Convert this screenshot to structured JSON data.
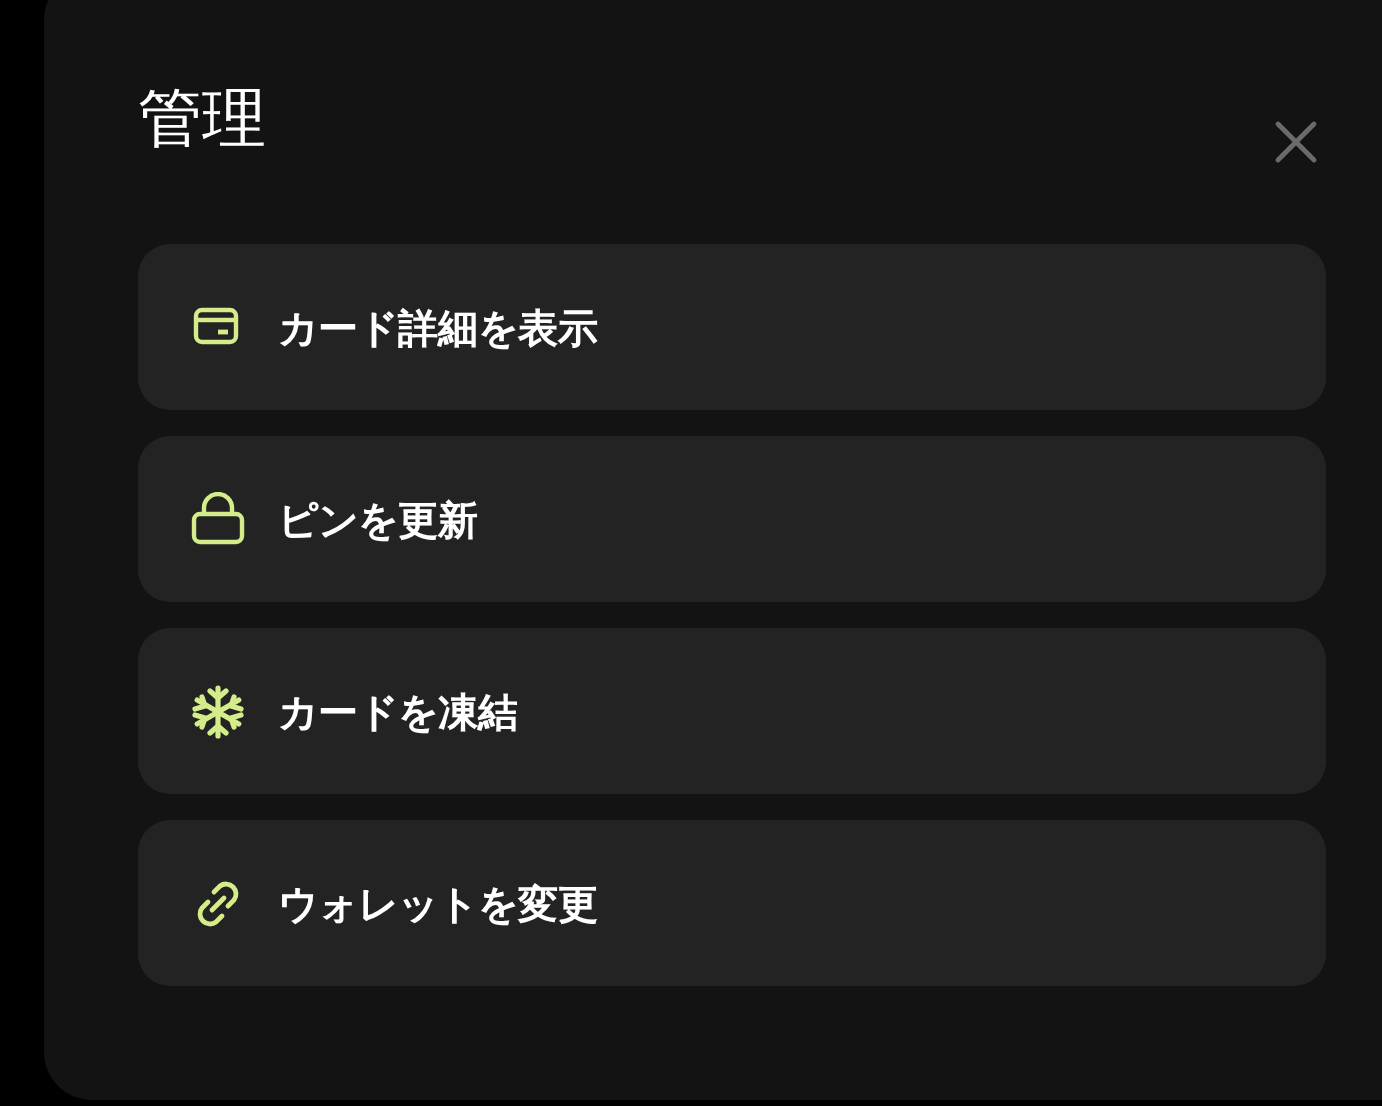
{
  "dialog": {
    "title": "管理",
    "items": [
      {
        "kind": "card",
        "label": "カード詳細を表示"
      },
      {
        "kind": "lock",
        "label": "ピンを更新"
      },
      {
        "kind": "snowflake",
        "label": "カードを凍結"
      },
      {
        "kind": "link",
        "label": "ウォレットを変更"
      }
    ]
  }
}
